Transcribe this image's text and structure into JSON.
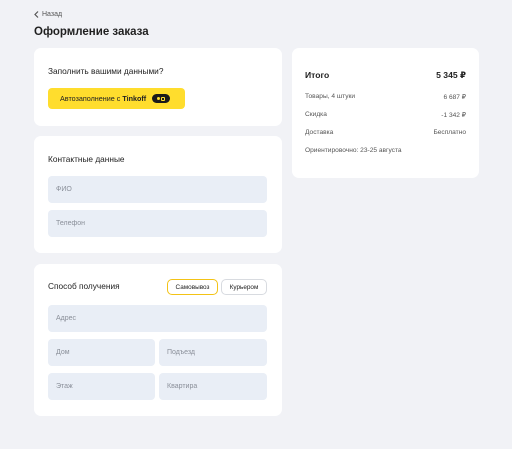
{
  "nav": {
    "back_label": "Назад"
  },
  "page": {
    "title": "Оформление заказа"
  },
  "autofill": {
    "heading": "Заполнить вашими данными?",
    "button_label": "Автозаполнение с",
    "button_brand": "Tinkoff",
    "brand_color": "#ffdd2d"
  },
  "contacts": {
    "heading": "Контактные данные",
    "fields": {
      "name_placeholder": "ФИО",
      "phone_placeholder": "Телефон"
    }
  },
  "delivery": {
    "heading": "Способ получения",
    "options": [
      {
        "label": "Самовывоз",
        "active": true
      },
      {
        "label": "Курьером",
        "active": false
      }
    ],
    "fields": {
      "address_placeholder": "Адрес",
      "house_placeholder": "Дом",
      "entrance_placeholder": "Подъезд",
      "floor_placeholder": "Этаж",
      "apartment_placeholder": "Квартира"
    }
  },
  "summary": {
    "total_label": "Итого",
    "total_value": "5 345 ₽",
    "rows": [
      {
        "label": "Товары, 4 штуки",
        "value": "6 687 ₽"
      },
      {
        "label": "Скидка",
        "value": "-1 342 ₽"
      },
      {
        "label": "Доставка",
        "value": "Бесплатно"
      }
    ],
    "eta": "Ориентировочно: 23-25 августа"
  },
  "colors": {
    "background": "#f1f2f6",
    "card": "#ffffff",
    "field": "#e9eef6",
    "accent": "#ffdd2d"
  }
}
